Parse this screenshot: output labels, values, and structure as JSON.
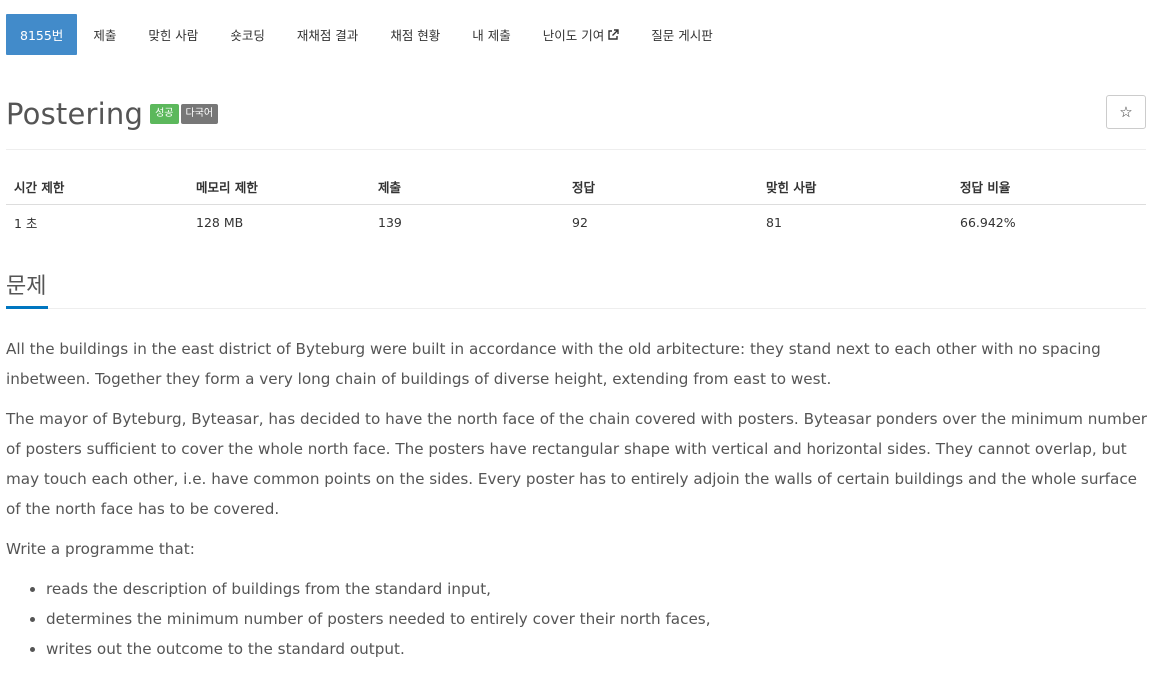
{
  "nav": {
    "tabs": [
      {
        "label": "8155번"
      },
      {
        "label": "제출"
      },
      {
        "label": "맞힌 사람"
      },
      {
        "label": "숏코딩"
      },
      {
        "label": "재채점 결과"
      },
      {
        "label": "채점 현황"
      },
      {
        "label": "내 제출"
      },
      {
        "label": "난이도 기여",
        "icon": "external-link-icon"
      },
      {
        "label": "질문 게시판"
      }
    ]
  },
  "problem": {
    "title": "Postering",
    "badges": {
      "status": "성공",
      "lang": "다국어"
    },
    "star_icon": "☆"
  },
  "info": {
    "headers": [
      "시간 제한",
      "메모리 제한",
      "제출",
      "정답",
      "맞힌 사람",
      "정답 비율"
    ],
    "values": [
      "1 초",
      "128 MB",
      "139",
      "92",
      "81",
      "66.942%"
    ]
  },
  "section": {
    "title": "문제"
  },
  "description": {
    "p1": "All the buildings in the east district of Byteburg were built in accordance with the old arbitecture: they stand next to each other with no spacing inbetween. Together they form a very long chain of buildings of diverse height, extending from east to west.",
    "p2": "The mayor of Byteburg, Byteasar, has decided to have the north face of the chain covered with posters. Byteasar ponders over the minimum number of posters sufficient to cover the whole north face. The posters have rectangular shape with vertical and horizontal sides. They cannot overlap, but may touch each other, i.e. have common points on the sides. Every poster has to entirely adjoin the walls of certain buildings and the whole surface of the north face has to be covered.",
    "p3": "Write a programme that:",
    "items": [
      "reads the description of buildings from the standard input,",
      "determines the minimum number of posters needed to entirely cover their north faces,",
      "writes out the outcome to the standard output."
    ]
  },
  "colors": {
    "active_tab": "#428bca",
    "success_badge": "#5cb85c",
    "lang_badge": "#777777",
    "section_underline": "#0076c0"
  }
}
